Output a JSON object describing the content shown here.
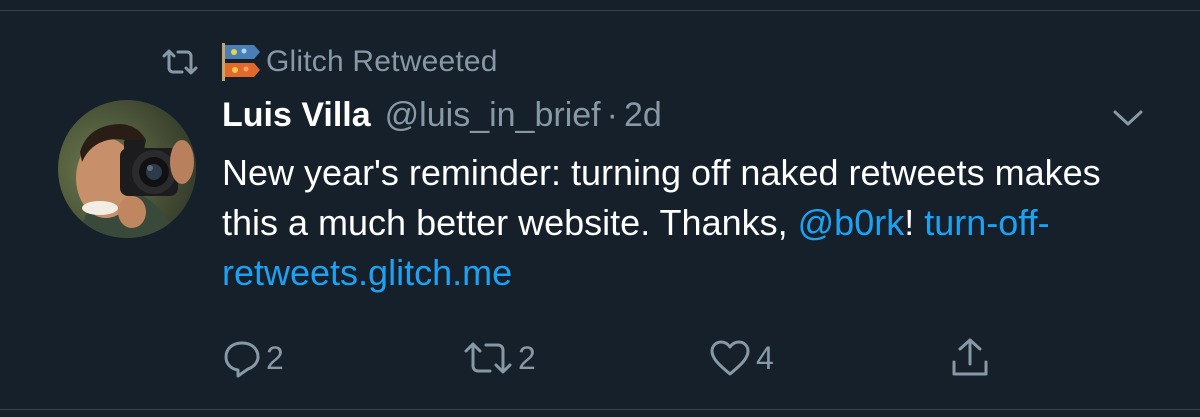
{
  "retweet_context": {
    "label": "Glitch Retweeted"
  },
  "tweet": {
    "author_name": "Luis Villa",
    "author_handle": "@luis_in_brief",
    "separator": "·",
    "time_ago": "2d",
    "text_part1": "New year's reminder: turning off naked retweets makes this a much better website. Thanks, ",
    "mention": "@b0rk",
    "text_part2": "! ",
    "url": "turn-off-retweets.glitch.me"
  },
  "actions": {
    "reply_count": "2",
    "retweet_count": "2",
    "like_count": "4"
  },
  "colors": {
    "background": "#15202b",
    "secondary_text": "#8899a6",
    "link": "#1da1f2",
    "divider": "#38444d"
  },
  "icons": [
    "retweet-icon",
    "glitch-logo-icon",
    "chevron-down-icon",
    "reply-icon",
    "like-icon",
    "share-icon"
  ]
}
